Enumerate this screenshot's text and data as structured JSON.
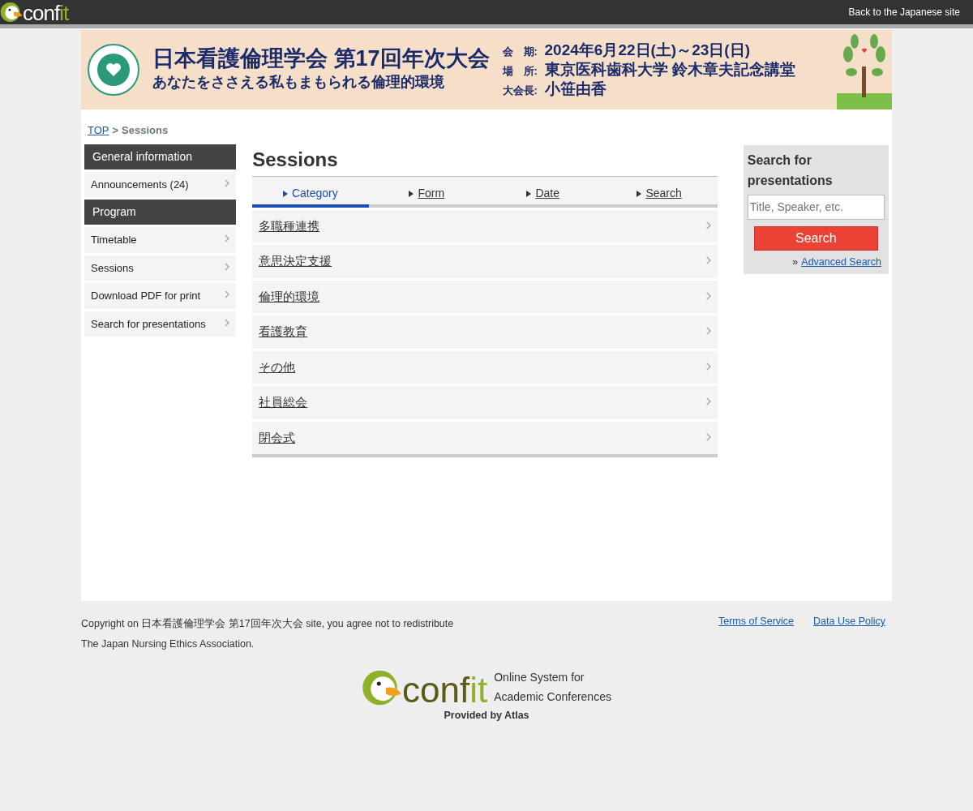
{
  "topbar": {
    "logo": {
      "main": "conf",
      "accent": "it"
    },
    "link": "Back to the Japanese site"
  },
  "banner": {
    "title": "日本看護倫理学会 第17回年次大会",
    "subtitle": "あなたをささえる私もまもられる倫理的環境",
    "details": [
      {
        "label": "会　期:",
        "value": "2024年6月22日(土)～23日(日)"
      },
      {
        "label": "場　所:",
        "value": "東京医科歯科大学 鈴木章夫記念講堂"
      },
      {
        "label": "大会長:",
        "value": "小笹由香"
      }
    ]
  },
  "breadcrumb": {
    "link": "TOP",
    "separator": ">",
    "current": "Sessions"
  },
  "sidebar": [
    {
      "heading": "General information",
      "items": [
        "Announcements (24)"
      ]
    },
    {
      "heading": "Program",
      "items": [
        "Timetable",
        "Sessions",
        "Download PDF for print",
        "Search for presentations"
      ]
    }
  ],
  "main": {
    "title": "Sessions",
    "tabs": [
      {
        "label": "Category",
        "selected": true
      },
      {
        "label": "Form",
        "selected": false
      },
      {
        "label": "Date",
        "selected": false
      },
      {
        "label": "Search",
        "selected": false
      }
    ],
    "sessions": [
      "多職種連携",
      "意思決定支援",
      "倫理的環境",
      "看護教育",
      "その他",
      "社員総会",
      "閉会式"
    ]
  },
  "search_panel": {
    "title": "Search for presentations",
    "placeholder": "Title, Speaker, etc.",
    "button": "Search",
    "prefix": "»",
    "advanced": "Advanced Search"
  },
  "footer": {
    "copyright": [
      "Copyright on 日本看護倫理学会 第17回年次大会 site, you agree not to redistribute",
      "The Japan Nursing Ethics Association."
    ],
    "links": [
      "Terms of Service",
      "Data Use Policy"
    ],
    "logo": {
      "main": "conf",
      "accent": "it"
    },
    "tagline": [
      "Online System for",
      "Academic Conferences"
    ],
    "provided": "Provided by Atlas"
  }
}
